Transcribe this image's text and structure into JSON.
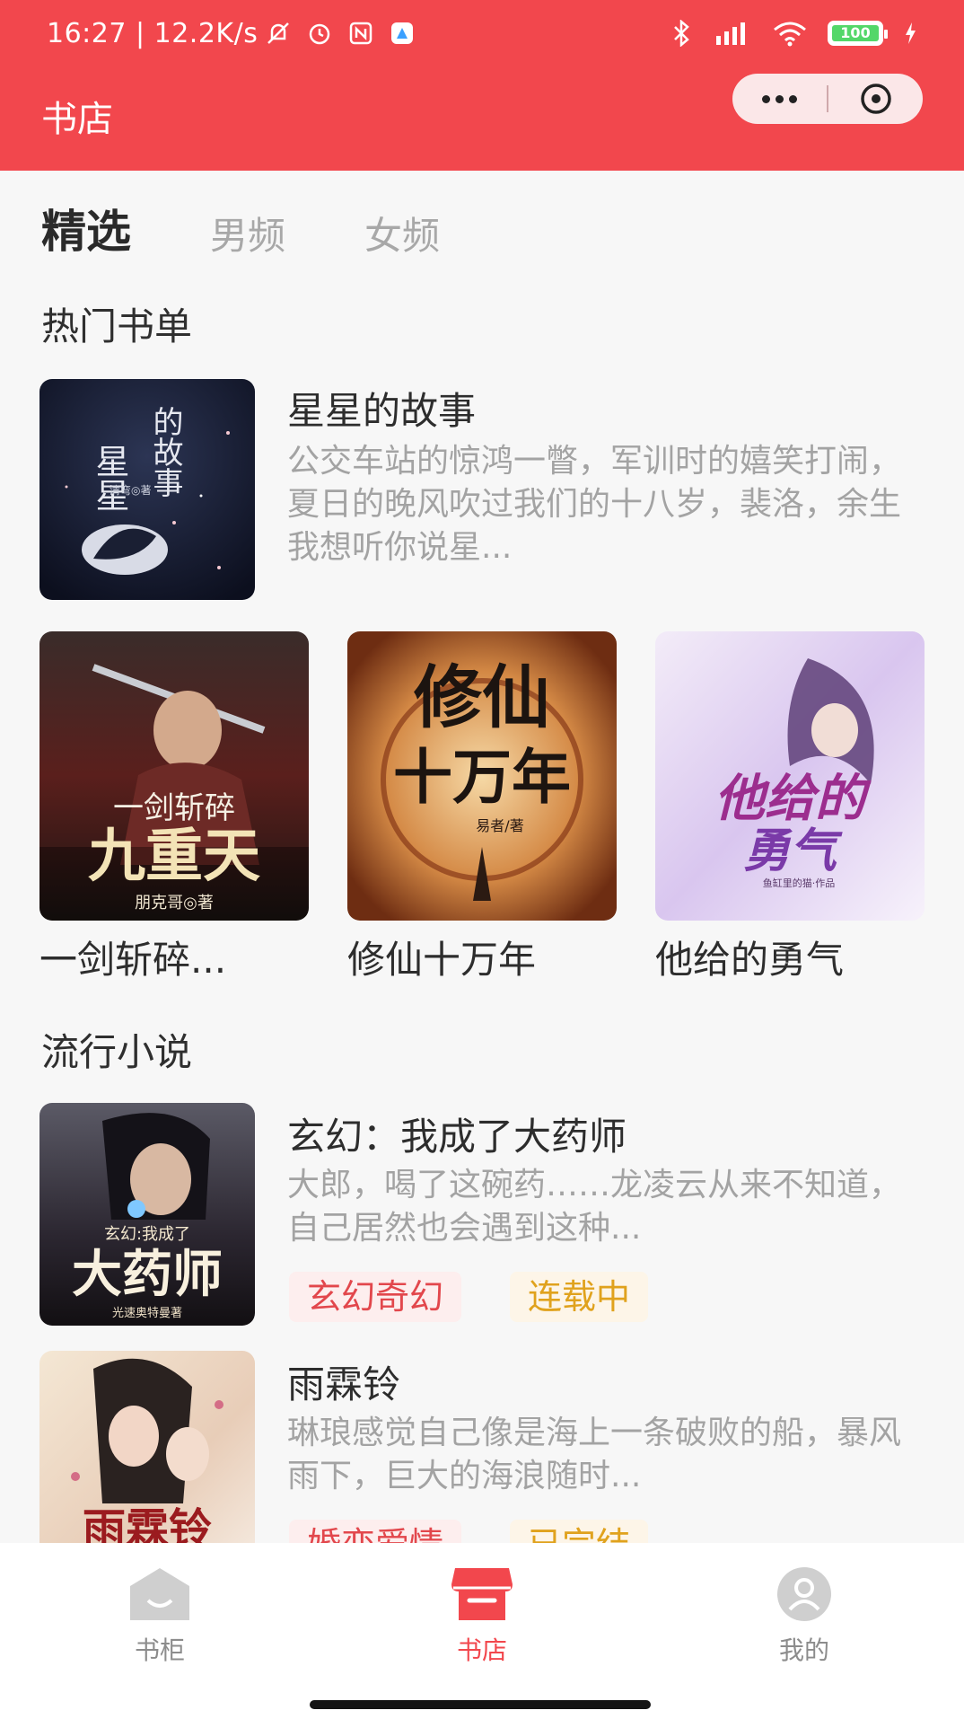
{
  "status_bar": {
    "time": "16:27 | 12.2K/s",
    "battery": "100"
  },
  "header": {
    "title": "书店"
  },
  "tabs": [
    {
      "label": "精选",
      "active": true
    },
    {
      "label": "男频",
      "active": false
    },
    {
      "label": "女频",
      "active": false
    }
  ],
  "sections": {
    "hot_lists": "热门书单",
    "popular": "流行小说"
  },
  "featured_book": {
    "title": "星星的故事",
    "description": "公交车站的惊鸿一瞥，军训时的嬉笑打闹，夏日的晚风吹过我们的十八岁，裴洛，余生我想听你说星...",
    "cover_text": [
      "星星",
      "的故事",
      "清弯◎著"
    ]
  },
  "grid_books": [
    {
      "title": "一剑斩碎...",
      "cover_text": [
        "一剑斩碎",
        "九重天",
        "朋克哥◎著"
      ]
    },
    {
      "title": "修仙十万年",
      "cover_text": [
        "修仙",
        "十万年",
        "易者/著"
      ]
    },
    {
      "title": "他给的勇气",
      "cover_text": [
        "他给的",
        "勇气",
        "鱼缸里的猫·作品"
      ]
    }
  ],
  "popular_books": [
    {
      "title": "玄幻：我成了大药师",
      "description": "大郎，喝了这碗药……龙凌云从来不知道，自己居然也会遇到这种...",
      "genre": "玄幻奇幻",
      "status": "连载中",
      "cover_text": [
        "玄幻:我成了",
        "大药师",
        "光速奥特曼著"
      ]
    },
    {
      "title": "雨霖铃",
      "description": "琳琅感觉自己像是海上一条破败的船，暴风雨下，巨大的海浪随时...",
      "genre": "婚恋爱情",
      "status": "已完结",
      "cover_text": [
        "雨霖铃"
      ]
    }
  ],
  "bottom_nav": [
    {
      "label": "书柜",
      "icon": "bookshelf-icon",
      "active": false
    },
    {
      "label": "书店",
      "icon": "store-icon",
      "active": true
    },
    {
      "label": "我的",
      "icon": "profile-icon",
      "active": false
    }
  ],
  "colors": {
    "brand": "#f2474d",
    "tag_genre": "#e2474c",
    "tag_status": "#e0a21d"
  }
}
